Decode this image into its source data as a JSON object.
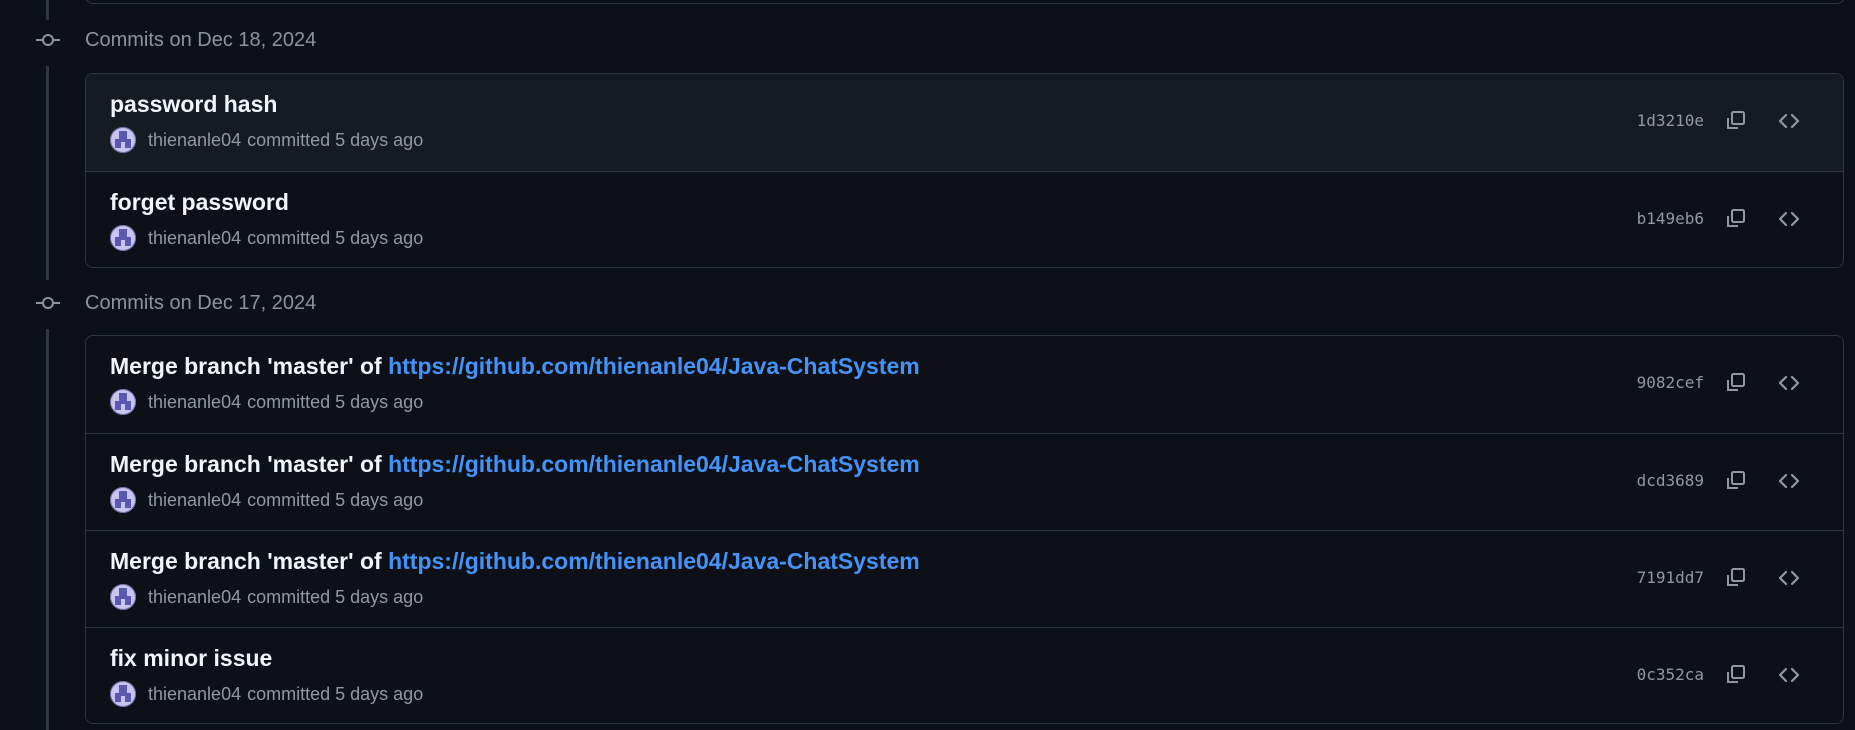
{
  "groups": [
    {
      "title": "Commits on Dec 18, 2024",
      "commits": [
        {
          "title": "password hash",
          "link": "",
          "author": "thienanle04",
          "action": "committed",
          "time": "5 days ago",
          "sha": "1d3210e",
          "hovered": true
        },
        {
          "title": "forget password",
          "link": "",
          "author": "thienanle04",
          "action": "committed",
          "time": "5 days ago",
          "sha": "b149eb6",
          "hovered": false
        }
      ]
    },
    {
      "title": "Commits on Dec 17, 2024",
      "commits": [
        {
          "title": "Merge branch 'master' of ",
          "link": "https://github.com/thienanle04/Java-ChatSystem",
          "author": "thienanle04",
          "action": "committed",
          "time": "5 days ago",
          "sha": "9082cef",
          "hovered": false
        },
        {
          "title": "Merge branch 'master' of ",
          "link": "https://github.com/thienanle04/Java-ChatSystem",
          "author": "thienanle04",
          "action": "committed",
          "time": "5 days ago",
          "sha": "dcd3689",
          "hovered": false
        },
        {
          "title": "Merge branch 'master' of ",
          "link": "https://github.com/thienanle04/Java-ChatSystem",
          "author": "thienanle04",
          "action": "committed",
          "time": "5 days ago",
          "sha": "7191dd7",
          "hovered": false
        },
        {
          "title": "fix minor issue",
          "link": "",
          "author": "thienanle04",
          "action": "committed",
          "time": "5 days ago",
          "sha": "0c352ca",
          "hovered": false
        }
      ]
    }
  ],
  "icons": {
    "commit_node": "git-commit-icon",
    "copy": "copy-icon",
    "browse": "code-icon"
  },
  "colors": {
    "background": "#0d1117",
    "border": "#30363d",
    "link": "#4493f8",
    "muted": "#9198a1",
    "title": "#f0f6fc"
  }
}
